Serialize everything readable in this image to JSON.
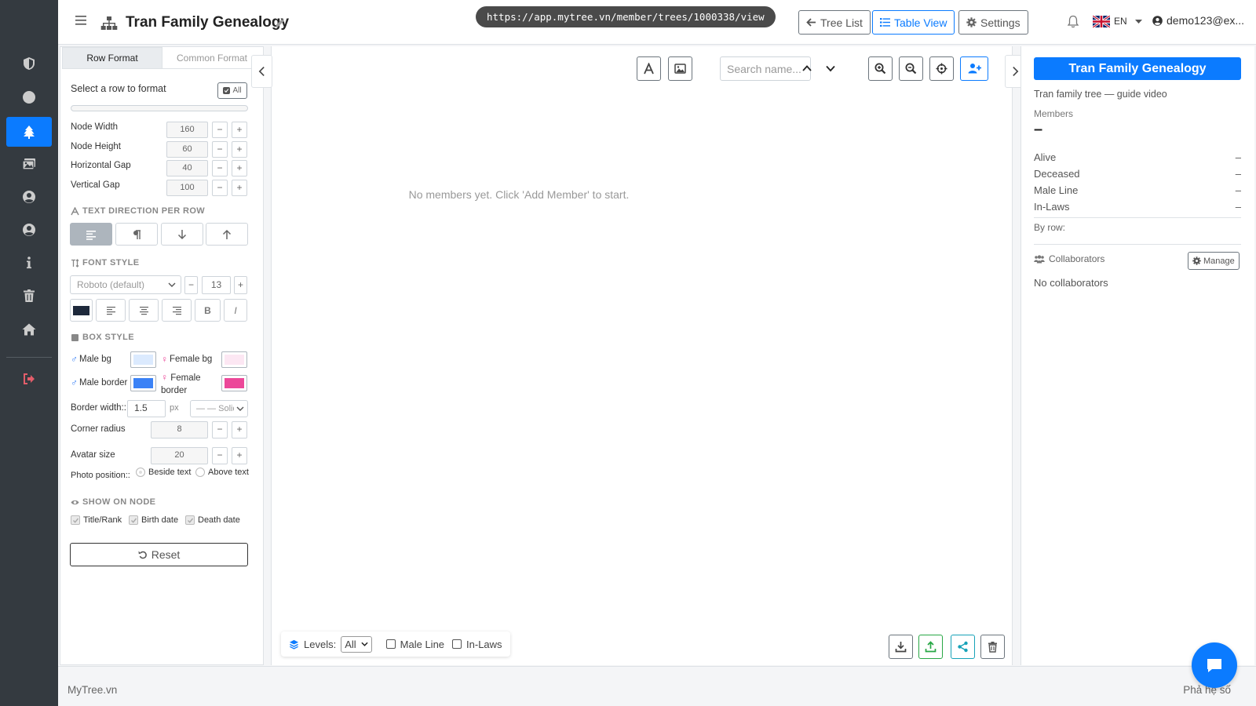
{
  "app": {
    "title": "Tran Family Genealogy",
    "url": "https://app.mytree.vn/member/trees/1000338/view",
    "accent_color": "#0b7bff",
    "rail_color": "#343a40"
  },
  "rail": {
    "items": [
      {
        "icon": "shield-icon"
      },
      {
        "icon": "circle-icon"
      },
      {
        "icon": "tree-icon",
        "active": true
      },
      {
        "icon": "images-icon"
      },
      {
        "icon": "user-circle-icon"
      },
      {
        "icon": "user-circle-icon"
      },
      {
        "icon": "info-icon"
      },
      {
        "icon": "trash-icon"
      },
      {
        "icon": "home-icon"
      },
      {
        "icon": "logout-icon"
      }
    ]
  },
  "header": {
    "tree_list_label": "Tree List",
    "table_view_label": "Table View",
    "settings_label": "Settings",
    "language": "EN",
    "user": "demo123@ex..."
  },
  "format_panel": {
    "tabs": [
      "Row Format",
      "Common Format"
    ],
    "active_tab": "Row Format",
    "select_row_label": "Select a row to format",
    "all_label": "All",
    "node_width_label": "Node Width",
    "node_width": "160",
    "node_height_label": "Node Height",
    "node_height": "60",
    "horizontal_gap_label": "Horizontal Gap",
    "horizontal_gap": "40",
    "vertical_gap_label": "Vertical Gap",
    "vertical_gap": "100",
    "text_direction_heading": "TEXT DIRECTION PER ROW",
    "font_style_heading": "FONT STYLE",
    "font_family": "Roboto (default)",
    "font_size": "13",
    "bold_label": "B",
    "italic_label": "I",
    "box_style_heading": "BOX STYLE",
    "male_bg_label": "Male bg",
    "female_bg_label": "Female bg",
    "male_border_label": "Male border",
    "female_border_label": "Female border",
    "colors": {
      "font": "#1e293b",
      "male_bg": "#dbeafe",
      "female_bg": "#fce7f3",
      "male_border": "#3b82f6",
      "female_border": "#ec4899"
    },
    "border_width_label": "Border width::",
    "border_width": "1.5",
    "border_width_unit": "px",
    "border_style": "— — Solid",
    "corner_radius_label": "Corner radius",
    "corner_radius": "8",
    "avatar_size_label": "Avatar size",
    "avatar_size": "20",
    "photo_position_label": "Photo position::",
    "photo_beside_label": "Beside text",
    "photo_above_label": "Above text",
    "show_on_node_heading": "SHOW ON NODE",
    "show_title_label": "Title/Rank",
    "show_birth_label": "Birth date",
    "show_death_label": "Death date",
    "reset_label": "Reset",
    "minus": "−",
    "plus": "+"
  },
  "canvas": {
    "search_placeholder": "Search name...",
    "empty_message": "No members yet. Click 'Add Member' to start.",
    "levels_label": "Levels:",
    "levels_value": "All",
    "male_line_label": "Male Line",
    "in_laws_label": "In-Laws"
  },
  "info_panel": {
    "title": "Tran Family Genealogy",
    "subtitle": "Tran family tree — guide video",
    "members_label": "Members",
    "members_value": "–",
    "alive_label": "Alive",
    "alive_value": "–",
    "deceased_label": "Deceased",
    "deceased_value": "–",
    "male_line_label": "Male Line",
    "male_line_value": "–",
    "in_laws_label": "In-Laws",
    "in_laws_value": "–",
    "by_row_label": "By row:",
    "collaborators_label": "Collaborators",
    "manage_label": "Manage",
    "no_collaborators": "No collaborators"
  },
  "footer": {
    "brand": "MyTree.vn",
    "right_text": "Phả hệ số"
  }
}
